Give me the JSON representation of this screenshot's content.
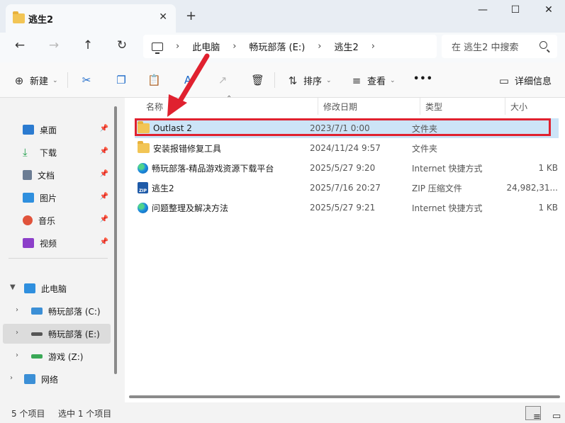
{
  "tab": {
    "title": "逃生2",
    "close": "✕",
    "new": "+"
  },
  "window": {
    "minimize": "—",
    "maximize": "☐",
    "close": "✕"
  },
  "nav": {
    "back": "←",
    "forward": "→",
    "up": "↑",
    "refresh": "↻"
  },
  "address": {
    "crumbs": [
      "此电脑",
      "畅玩部落 (E:)",
      "逃生2"
    ],
    "sep": "›"
  },
  "search": {
    "placeholder": "在 逃生2 中搜索"
  },
  "toolbar": {
    "new_label": "新建",
    "sort_label": "排序",
    "view_label": "查看",
    "more_label": "•••",
    "details_label": "详细信息"
  },
  "sidebar": {
    "quick": [
      {
        "label": "桌面",
        "icon": "desktop-icon",
        "color": "#2b7bd0"
      },
      {
        "label": "下载",
        "icon": "download-icon",
        "color": "#1f9e4a"
      },
      {
        "label": "文档",
        "icon": "document-icon",
        "color": "#6b7c93"
      },
      {
        "label": "图片",
        "icon": "picture-icon",
        "color": "#2f8fde"
      },
      {
        "label": "音乐",
        "icon": "music-icon",
        "color": "#e0533b"
      },
      {
        "label": "视频",
        "icon": "video-icon",
        "color": "#8c3fc9"
      }
    ],
    "pc_label": "此电脑",
    "drives": [
      {
        "label": "畅玩部落 (C:)",
        "icon": "windows-drive-icon"
      },
      {
        "label": "畅玩部落 (E:)",
        "icon": "drive-icon"
      },
      {
        "label": "游戏 (Z:)",
        "icon": "drive-icon"
      }
    ],
    "network_label": "网络"
  },
  "columns": {
    "name": "名称",
    "date": "修改日期",
    "type": "类型",
    "size": "大小"
  },
  "files": [
    {
      "name": "Outlast 2",
      "date": "2023/7/1 0:00",
      "type": "文件夹",
      "size": "",
      "icon": "folder-icon",
      "selected": true
    },
    {
      "name": "安装报错修复工具",
      "date": "2024/11/24 9:57",
      "type": "文件夹",
      "size": "",
      "icon": "folder-icon",
      "selected": false
    },
    {
      "name": "畅玩部落-精品游戏资源下载平台",
      "date": "2025/5/27 9:20",
      "type": "Internet 快捷方式",
      "size": "1 KB",
      "icon": "edge-shortcut-icon",
      "selected": false
    },
    {
      "name": "逃生2",
      "date": "2025/7/16 20:27",
      "type": "ZIP 压缩文件",
      "size": "24,982,31...",
      "icon": "zip-icon",
      "selected": false
    },
    {
      "name": "问题整理及解决方法",
      "date": "2025/5/27 9:21",
      "type": "Internet 快捷方式",
      "size": "1 KB",
      "icon": "edge-shortcut-icon",
      "selected": false
    }
  ],
  "status": {
    "count": "5 个项目",
    "selection": "选中 1 个项目"
  },
  "colors": {
    "highlight": "#e0212f",
    "selection": "#cce4f7",
    "folder": "#f2c555"
  }
}
